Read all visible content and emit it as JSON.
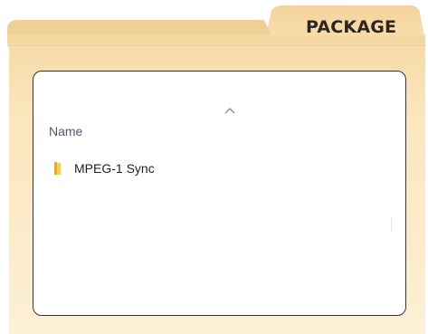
{
  "folder": {
    "tab_label": "PACKAGE",
    "colors": {
      "folder_body": "#fbe6bb",
      "folder_top": "#f3d59d",
      "tab": "#f6d9a4",
      "panel_border": "#3a3430"
    }
  },
  "explorer": {
    "sort_icon": "chevron-up-icon",
    "column_header": "Name",
    "items": [
      {
        "name": "MPEG-1 Sync",
        "icon": "folder-icon"
      }
    ]
  }
}
